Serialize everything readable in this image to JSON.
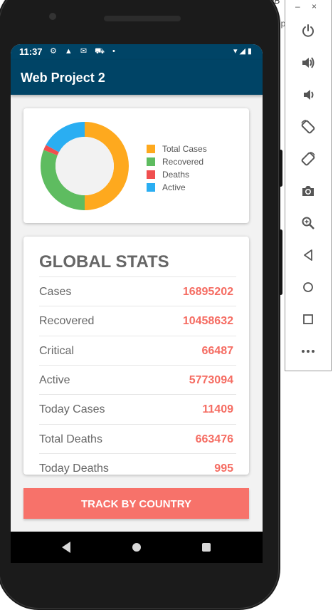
{
  "status_bar": {
    "time": "11:37",
    "icons_left": "⚙ ▲ ✉ ⛟ •",
    "icons_right": "▾◢▮"
  },
  "app_bar": {
    "title": "Web Project 2"
  },
  "chart_data": {
    "type": "pie",
    "legend": [
      "Total Cases",
      "Recovered",
      "Deaths",
      "Active"
    ],
    "colors": [
      "#fea91e",
      "#5ebc60",
      "#f04f4f",
      "#2aaef2"
    ],
    "values": [
      16895202,
      10458632,
      663476,
      5773094
    ]
  },
  "stats": {
    "title": "GLOBAL STATS",
    "rows": [
      {
        "label": "Cases",
        "value": "16895202"
      },
      {
        "label": "Recovered",
        "value": "10458632"
      },
      {
        "label": "Critical",
        "value": "66487"
      },
      {
        "label": "Active",
        "value": "5773094"
      },
      {
        "label": "Today Cases",
        "value": "11409"
      },
      {
        "label": "Total Deaths",
        "value": "663476"
      },
      {
        "label": "Today Deaths",
        "value": "995"
      }
    ]
  },
  "track_button": {
    "label": "TRACK BY COUNTRY"
  },
  "emulator_toolbar": {
    "minimize": "–",
    "close": "×",
    "buttons": [
      "power-icon",
      "volume-up-icon",
      "volume-down-icon",
      "rotate-left-icon",
      "rotate-right-icon",
      "camera-icon",
      "zoom-icon",
      "back-icon",
      "home-icon",
      "overview-icon",
      "more-icon"
    ]
  },
  "background": {
    "text_top": "auB",
    "text_side": "np"
  }
}
